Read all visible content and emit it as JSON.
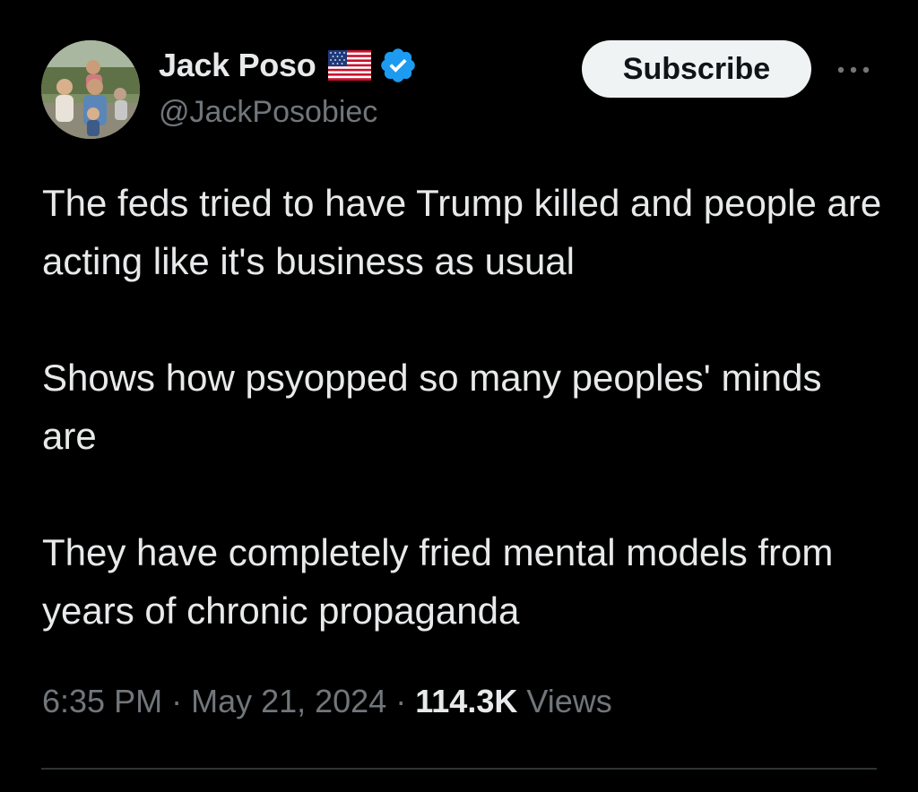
{
  "author": {
    "display_name": "Jack Poso",
    "handle": "@JackPosobiec",
    "avatar_icon": "family-photo-avatar",
    "flag_icon": "us-flag-icon",
    "verified_icon": "verified-badge-icon",
    "verified_color": "#1d9bf0"
  },
  "actions": {
    "subscribe_label": "Subscribe",
    "more_icon": "more-options-icon"
  },
  "tweet": {
    "paragraphs": [
      "The feds tried to have Trump killed and people are acting like it's business as usual",
      "Shows how psyopped so many peoples' minds are",
      "They have completely fried mental models from years of chronic propaganda"
    ]
  },
  "meta": {
    "time": "6:35 PM",
    "separator": "·",
    "date": "May 21, 2024",
    "views_count": "114.3K",
    "views_label": "Views"
  },
  "colors": {
    "background": "#000000",
    "text_primary": "#e7e9ea",
    "text_secondary": "#71767b",
    "button_bg": "#eff3f4",
    "divider": "#2f3336"
  }
}
